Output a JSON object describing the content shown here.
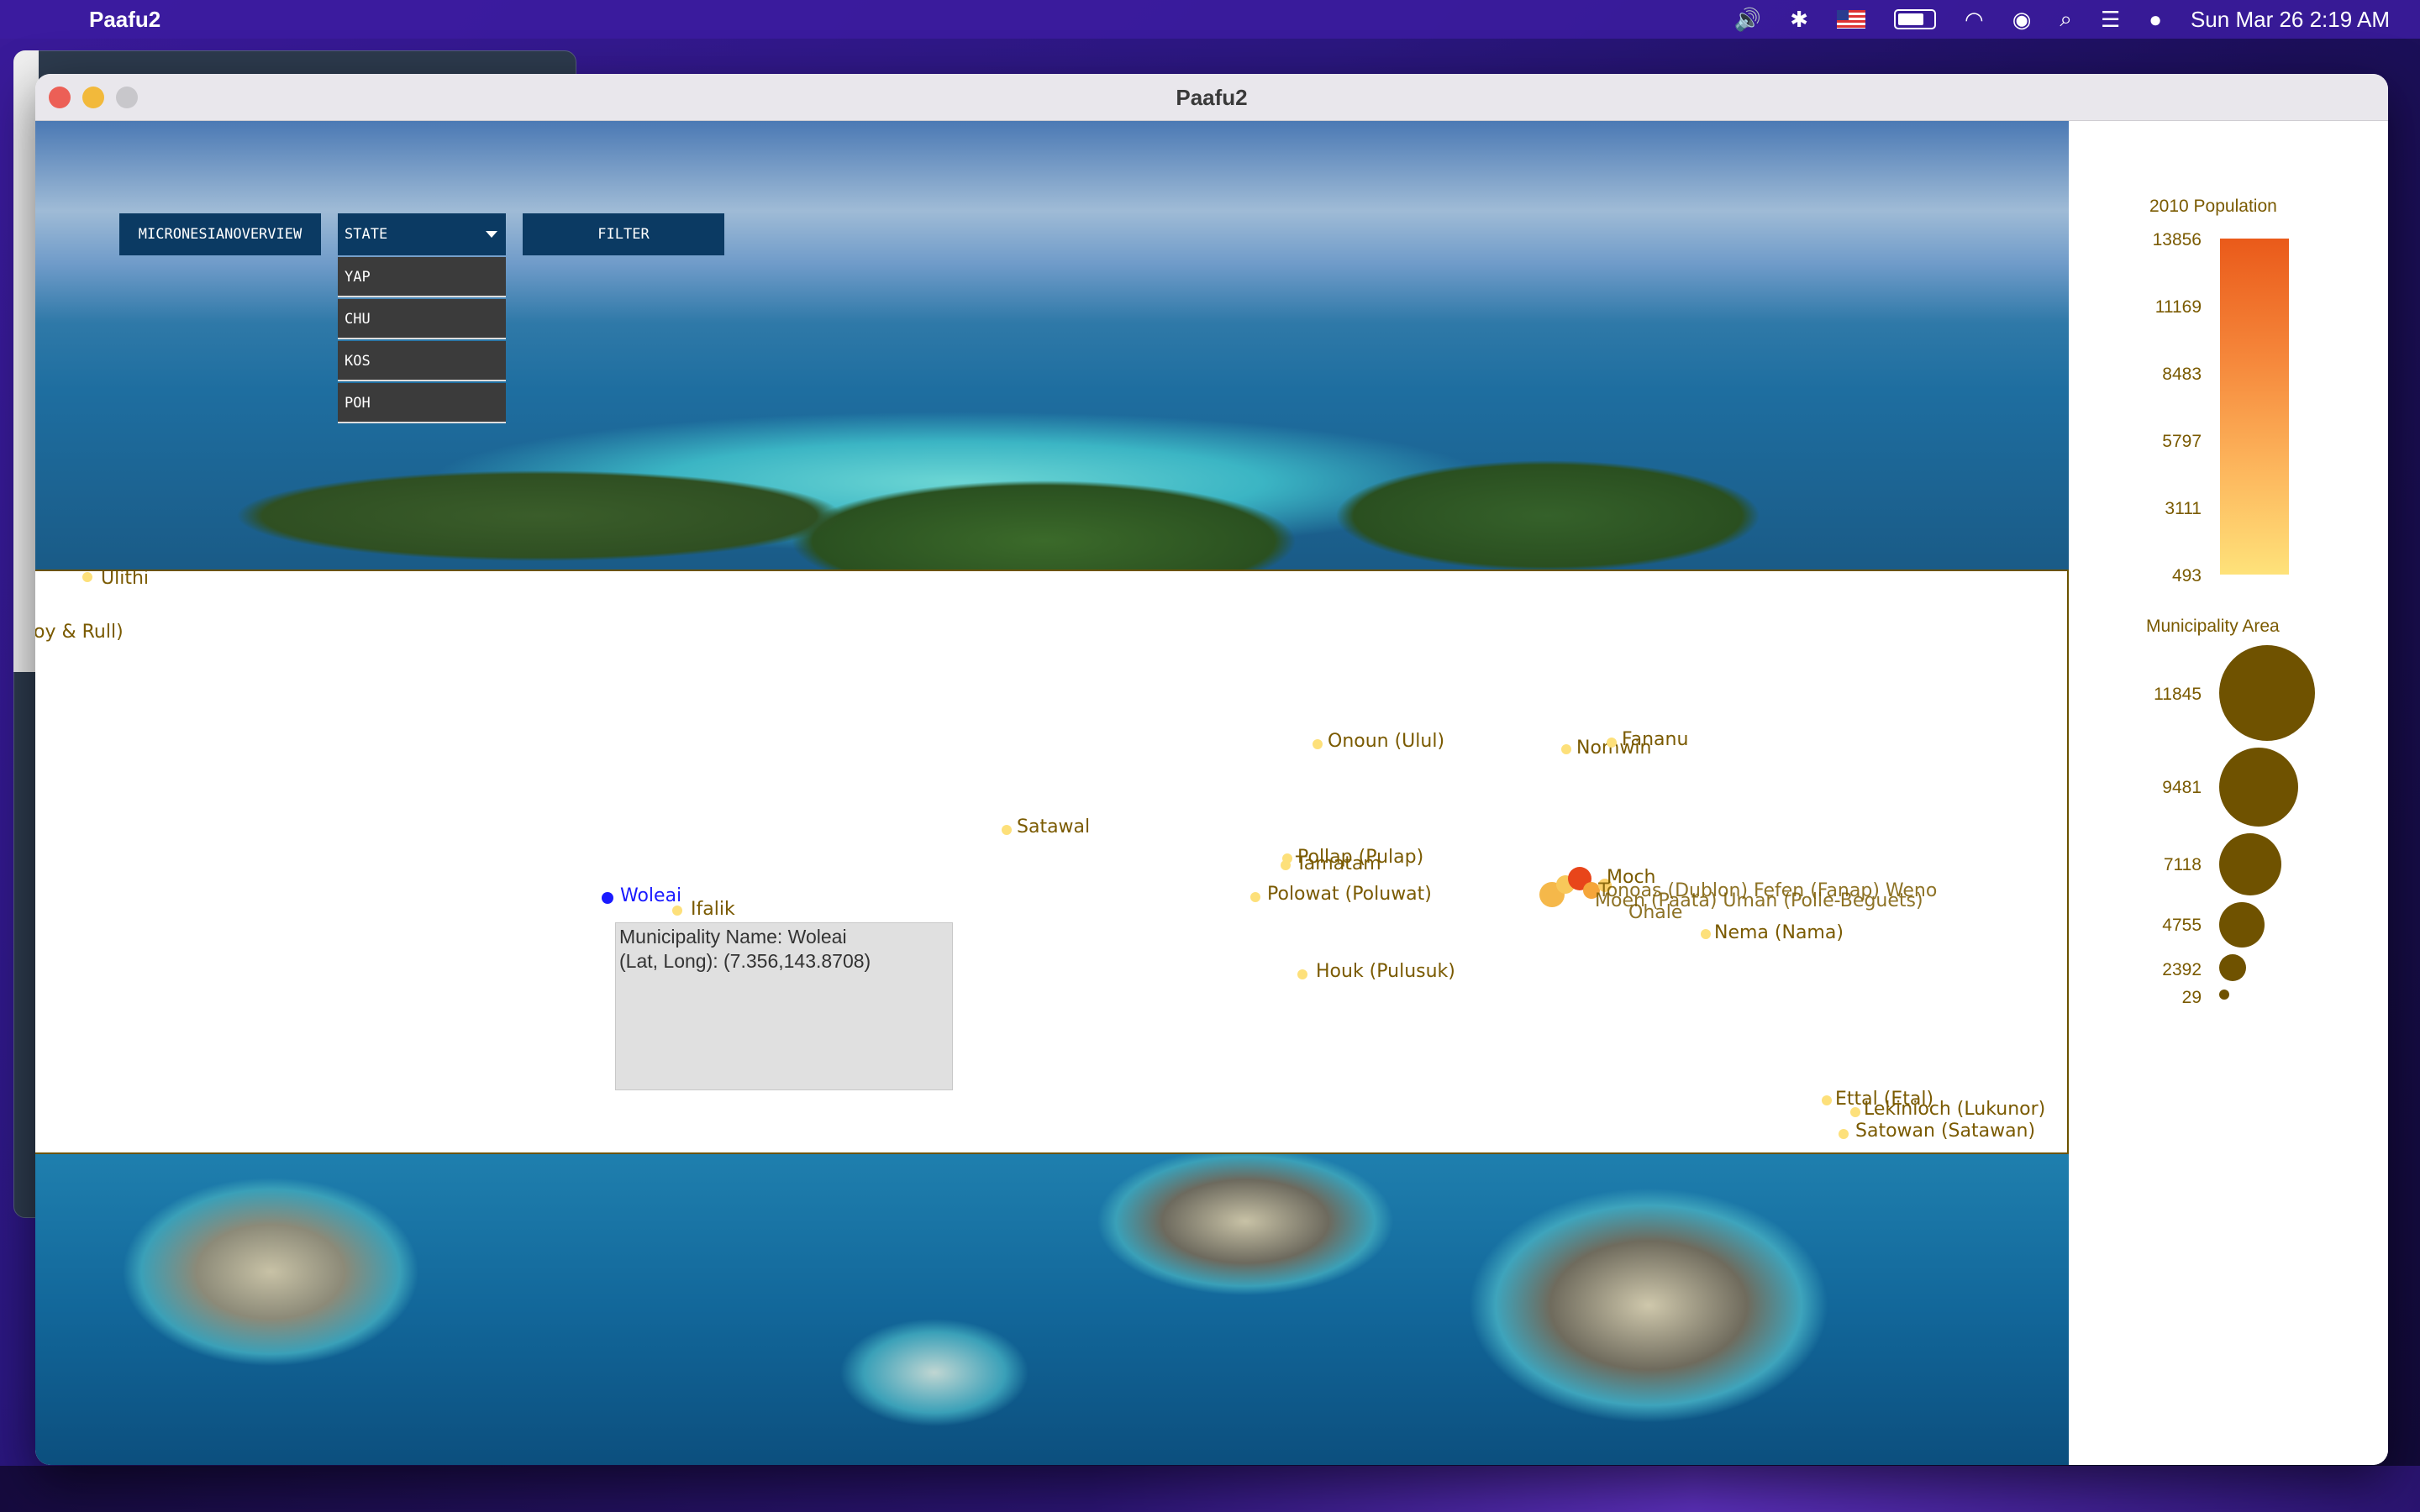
{
  "menubar": {
    "app_name": "Paafu2",
    "datetime": "Sun Mar 26  2:19 AM"
  },
  "window": {
    "title": "Paafu2"
  },
  "controls": {
    "overview_label": "MICRONESIANOVERVIEW",
    "select_value": "STATE",
    "options": [
      "YAP",
      "CHU",
      "KOS",
      "POH"
    ],
    "filter_label": "FILTER"
  },
  "map": {
    "labels": [
      {
        "name": "Ulithi"
      },
      {
        "name": "oy & Rull)"
      },
      {
        "name": "Onoun (Ulul)"
      },
      {
        "name": "Nomwin"
      },
      {
        "name": "Fananu"
      },
      {
        "name": "Satawal"
      },
      {
        "name": "Pollap (Pulap)"
      },
      {
        "name": "Tamatam"
      },
      {
        "name": "Polowat (Poluwat)"
      },
      {
        "name": "Woleai",
        "selected": true
      },
      {
        "name": "Ifalik"
      },
      {
        "name": "Moch"
      },
      {
        "name": "Houk (Pulusuk)"
      },
      {
        "name": "Nema (Nama)"
      },
      {
        "name": "Ettal (Etal)"
      },
      {
        "name": "Lekinioch (Lukunor)"
      },
      {
        "name": "Satowan (Satawan)"
      }
    ],
    "tooltip": {
      "line1": "Municipality Name: Woleai",
      "line2": "(Lat, Long): (7.356,143.8708)"
    }
  },
  "legend": {
    "population_title": "2010 Population",
    "population_ticks": [
      "13856",
      "11169",
      "8483",
      "5797",
      "3111",
      "493"
    ],
    "area_title": "Municipality Area",
    "area_ticks": [
      "11845",
      "9481",
      "7118",
      "4755",
      "2392",
      "29"
    ]
  },
  "colors": {
    "accent": "#0b3a63",
    "label_text": "#7a5a00",
    "selected": "#1a1aff",
    "point_light": "#fde07a",
    "point_hot": "#e8451a"
  }
}
